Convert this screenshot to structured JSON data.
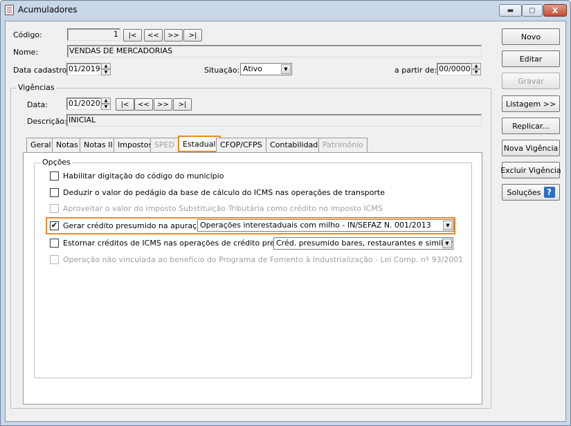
{
  "window": {
    "title": "Acumuladores",
    "min_label": "▬",
    "max_label": "▢",
    "close_label": "X"
  },
  "form": {
    "codigo_label": "Código:",
    "codigo_value": "1",
    "nav": {
      "first": "|<",
      "prev": "<<",
      "next": ">>",
      "last": ">|"
    },
    "nome_label": "Nome:",
    "nome_value": "VENDAS DE MERCADORIAS",
    "data_cadastro_label": "Data cadastro:",
    "data_cadastro_value": "01/2019",
    "situacao_label": "Situação:",
    "situacao_value": "Ativo",
    "a_partir_label": "a partir de:",
    "a_partir_value": "00/0000"
  },
  "vigencias": {
    "group_label": "Vigências",
    "data_label": "Data:",
    "data_value": "01/2020",
    "descricao_label": "Descrição:",
    "descricao_value": "INICIAL"
  },
  "tabs": [
    {
      "label": "Geral",
      "state": "normal"
    },
    {
      "label": "Notas",
      "state": "normal"
    },
    {
      "label": "Notas II",
      "state": "normal"
    },
    {
      "label": "Impostos",
      "state": "normal"
    },
    {
      "label": "SPED",
      "state": "disabled"
    },
    {
      "label": "Estadual",
      "state": "active"
    },
    {
      "label": "CFOP/CFPS",
      "state": "normal"
    },
    {
      "label": "Contabilidade",
      "state": "normal"
    },
    {
      "label": "Patrimônio",
      "state": "disabled"
    }
  ],
  "opcoes": {
    "group_label": "Opções",
    "items": [
      {
        "label": "Habilitar digitação do código do município",
        "checked": false,
        "enabled": true
      },
      {
        "label": "Deduzir o valor do pedágio da base de cálculo do ICMS nas operações de transporte",
        "checked": false,
        "enabled": true
      },
      {
        "label": "Aproveitar o valor do imposto Substituição Tributária como crédito no imposto ICMS",
        "checked": false,
        "enabled": false
      },
      {
        "label": "Gerar crédito presumido na apuração",
        "checked": true,
        "enabled": true,
        "select": "Operações interestaduais com milho - IN/SEFAZ N. 001/2013"
      },
      {
        "label": "Estornar créditos de ICMS nas operações de crédito presumido",
        "checked": false,
        "enabled": true,
        "select": "Créd. presumido bares, restaurantes e similiares - A"
      },
      {
        "label": "Operação não vinculada ao benefício do Programa de Fomento à Industrialização - Lei Comp. nº 93/2001",
        "checked": false,
        "enabled": false
      }
    ]
  },
  "side_buttons": {
    "novo": "Novo",
    "editar": "Editar",
    "gravar": "Gravar",
    "listagem": "Listagem >>",
    "replicar": "Replicar...",
    "nova_vigencia": "Nova Vigência",
    "excluir_vigencia": "Excluir Vigência",
    "solucoes": "Soluções",
    "help_glyph": "?"
  },
  "colors": {
    "highlight": "#ee8a1e",
    "title_bg": "#c9d7e8",
    "help_blue": "#2a6ec6"
  }
}
